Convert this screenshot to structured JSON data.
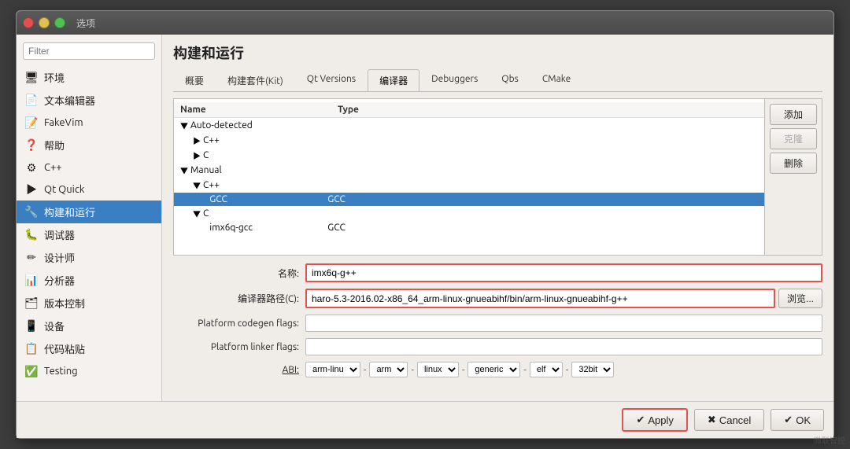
{
  "window": {
    "title": "选项"
  },
  "sidebar": {
    "filter_placeholder": "Filter",
    "items": [
      {
        "id": "environment",
        "label": "环境",
        "icon": "🖥"
      },
      {
        "id": "text-editor",
        "label": "文本编辑器",
        "icon": "📄"
      },
      {
        "id": "fakevim",
        "label": "FakeVim",
        "icon": "📝"
      },
      {
        "id": "help",
        "label": "帮助",
        "icon": "❓"
      },
      {
        "id": "cpp",
        "label": "C++",
        "icon": "⚙"
      },
      {
        "id": "qt-quick",
        "label": "Qt Quick",
        "icon": "▶"
      },
      {
        "id": "build-run",
        "label": "构建和运行",
        "icon": "🔧",
        "active": true
      },
      {
        "id": "debugger",
        "label": "调试器",
        "icon": "🐛"
      },
      {
        "id": "designer",
        "label": "设计师",
        "icon": "✏"
      },
      {
        "id": "analyzer",
        "label": "分析器",
        "icon": "📊"
      },
      {
        "id": "version-control",
        "label": "版本控制",
        "icon": "🗂"
      },
      {
        "id": "devices",
        "label": "设备",
        "icon": "📱"
      },
      {
        "id": "code-snippet",
        "label": "代码粘贴",
        "icon": "📋"
      },
      {
        "id": "testing",
        "label": "Testing",
        "icon": "✅"
      }
    ]
  },
  "main": {
    "title": "构建和运行",
    "tabs": [
      {
        "id": "overview",
        "label": "概要"
      },
      {
        "id": "kits",
        "label": "构建套件(Kit)"
      },
      {
        "id": "qt-versions",
        "label": "Qt Versions"
      },
      {
        "id": "compilers",
        "label": "编译器",
        "active": true
      },
      {
        "id": "debuggers",
        "label": "Debuggers"
      },
      {
        "id": "qbs",
        "label": "Qbs"
      },
      {
        "id": "cmake",
        "label": "CMake"
      }
    ],
    "tree": {
      "columns": [
        {
          "id": "name",
          "label": "Name"
        },
        {
          "id": "type",
          "label": "Type"
        }
      ],
      "rows": [
        {
          "indent": 0,
          "arrow": "▼",
          "name": "Auto-detected",
          "type": "",
          "expanded": true
        },
        {
          "indent": 1,
          "arrow": "▶",
          "name": "C++",
          "type": "",
          "expanded": false
        },
        {
          "indent": 1,
          "arrow": "▶",
          "name": "C",
          "type": "",
          "expanded": false
        },
        {
          "indent": 0,
          "arrow": "▼",
          "name": "Manual",
          "type": "",
          "expanded": true
        },
        {
          "indent": 1,
          "arrow": "▼",
          "name": "C++",
          "type": "",
          "expanded": true
        },
        {
          "indent": 2,
          "arrow": "",
          "name": "GCC",
          "type": "GCC",
          "selected": true
        },
        {
          "indent": 1,
          "arrow": "▼",
          "name": "C",
          "type": "",
          "expanded": true
        },
        {
          "indent": 2,
          "arrow": "",
          "name": "imx6q-gcc",
          "type": "GCC",
          "selected": false
        }
      ]
    },
    "buttons": {
      "add": "添加",
      "clone": "克隆",
      "delete": "删除"
    },
    "form": {
      "name_label": "名称:",
      "name_value": "imx6q-g++",
      "compiler_path_label": "编译器路径(C):",
      "compiler_path_value": "haro-5.3-2016.02-x86_64_arm-linux-gnueabihf/bin/arm-linux-gnueabihf-g++",
      "browse_label": "浏览...",
      "platform_codegen_label": "Platform codegen flags:",
      "platform_codegen_value": "",
      "platform_linker_label": "Platform linker flags:",
      "platform_linker_value": "",
      "abi_label": "ABI:",
      "abi_selects": [
        {
          "value": "arm-linu",
          "options": [
            "arm-linu"
          ]
        },
        {
          "value": "arm",
          "options": [
            "arm"
          ]
        },
        {
          "value": "linux",
          "options": [
            "linux"
          ]
        },
        {
          "value": "generic",
          "options": [
            "generic"
          ]
        },
        {
          "value": "elf",
          "options": [
            "elf"
          ]
        },
        {
          "value": "32bit",
          "options": [
            "32bit"
          ]
        }
      ]
    },
    "bottom_buttons": {
      "apply": "Apply",
      "cancel": "Cancel",
      "ok": "OK"
    }
  },
  "watermark": "微联智控"
}
